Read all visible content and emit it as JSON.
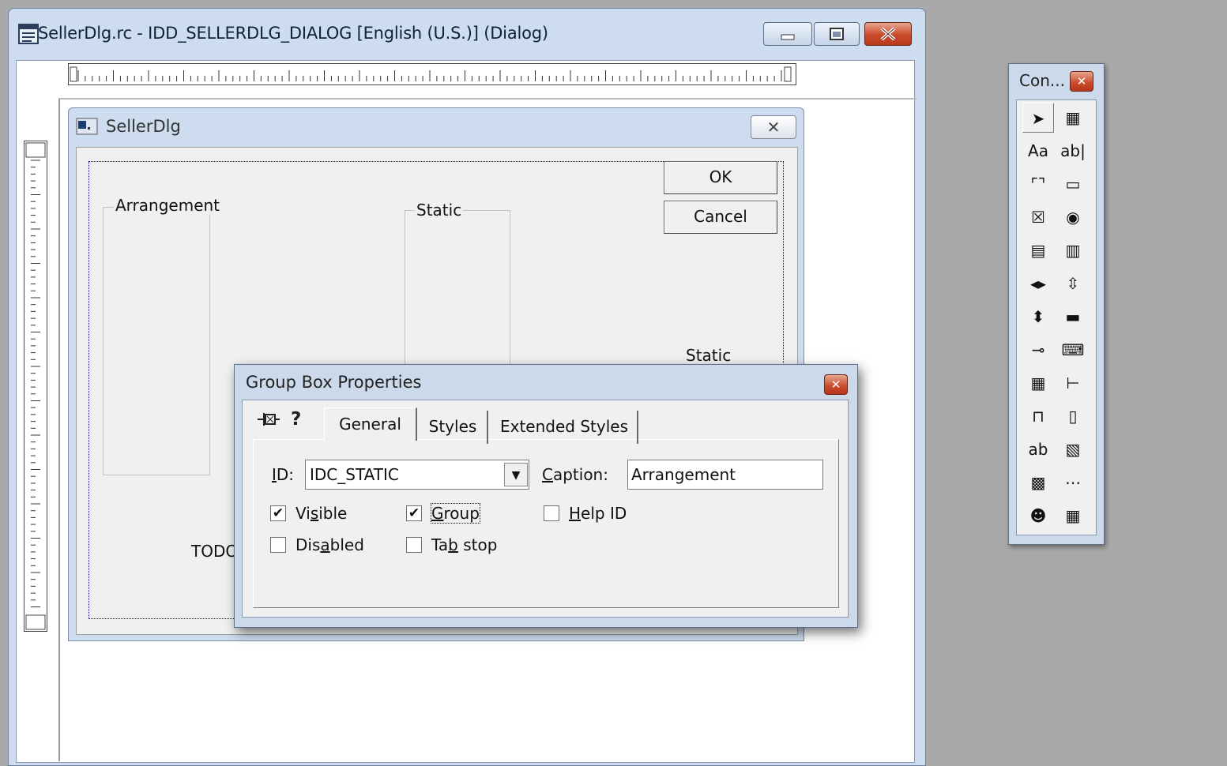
{
  "editor": {
    "title": "SellerDlg.rc - IDD_SELLERDLG_DIALOG [English (U.S.)] (Dialog)",
    "minimize_glyph": "▭",
    "maximize_glyph": "□",
    "close_glyph": "✕"
  },
  "dialog": {
    "title": "SellerDlg",
    "close_glyph": "✕",
    "ok_label": "OK",
    "cancel_label": "Cancel",
    "group_arrangement_label": "Arrangement",
    "group_static_label": "Static",
    "static_right_label": "Static",
    "todo_label": "TODO"
  },
  "props": {
    "title": "Group Box Properties",
    "close_glyph": "✕",
    "pin_glyph": "⊣⊠",
    "help_glyph": "?",
    "tabs": [
      "General",
      "Styles",
      "Extended Styles"
    ],
    "id_label": "ID:",
    "id_value": "IDC_STATIC",
    "caption_label": "Caption:",
    "caption_value": "Arrangement",
    "checkboxes": {
      "visible": {
        "label": "Visible",
        "checked": true
      },
      "group": {
        "label": "Group",
        "checked": true
      },
      "help_id": {
        "label": "Help ID",
        "checked": false
      },
      "disabled": {
        "label": "Disabled",
        "checked": false
      },
      "tab_stop": {
        "label": "Tab stop",
        "checked": false
      }
    }
  },
  "toolbox": {
    "title": "Con...",
    "close_glyph": "✕",
    "tools": [
      {
        "name": "pointer-tool-icon",
        "glyph": "➤"
      },
      {
        "name": "picture-control-tool-icon",
        "glyph": "▦"
      },
      {
        "name": "static-text-tool-icon",
        "glyph": "Aa"
      },
      {
        "name": "edit-control-tool-icon",
        "glyph": "ab|"
      },
      {
        "name": "group-box-tool-icon",
        "glyph": "⌜⌝"
      },
      {
        "name": "button-tool-icon",
        "glyph": "▭"
      },
      {
        "name": "check-box-tool-icon",
        "glyph": "☒"
      },
      {
        "name": "radio-button-tool-icon",
        "glyph": "◉"
      },
      {
        "name": "combo-box-tool-icon",
        "glyph": "▤"
      },
      {
        "name": "list-box-tool-icon",
        "glyph": "▥"
      },
      {
        "name": "horizontal-scrollbar-tool-icon",
        "glyph": "◂▸"
      },
      {
        "name": "vertical-scrollbar-tool-icon",
        "glyph": "⇳"
      },
      {
        "name": "spin-control-tool-icon",
        "glyph": "⬍"
      },
      {
        "name": "progress-control-tool-icon",
        "glyph": "▬"
      },
      {
        "name": "slider-control-tool-icon",
        "glyph": "⊸"
      },
      {
        "name": "hot-key-tool-icon",
        "glyph": "⌨"
      },
      {
        "name": "list-control-tool-icon",
        "glyph": "▦"
      },
      {
        "name": "tree-control-tool-icon",
        "glyph": "⊢"
      },
      {
        "name": "tab-control-tool-icon",
        "glyph": "⊓"
      },
      {
        "name": "animation-control-tool-icon",
        "glyph": "▯"
      },
      {
        "name": "rich-edit-tool-icon",
        "glyph": "ab"
      },
      {
        "name": "date-time-picker-tool-icon",
        "glyph": "▧"
      },
      {
        "name": "month-calendar-tool-icon",
        "glyph": "▩"
      },
      {
        "name": "ip-address-tool-icon",
        "glyph": "⋯"
      },
      {
        "name": "custom-control-tool-icon",
        "glyph": "☻"
      },
      {
        "name": "extended-combo-tool-icon",
        "glyph": "▦"
      }
    ]
  },
  "colors": {
    "desktop": "#a9a9a9",
    "window_frame": "#cddcee",
    "dialog_face": "#f0f0f0",
    "close_red": "#c94a2b"
  }
}
